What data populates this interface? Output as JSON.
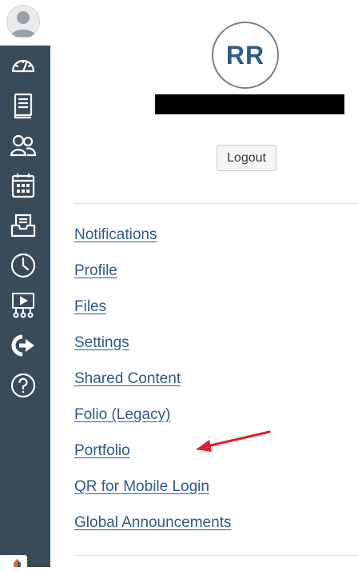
{
  "rail": {
    "items": [
      {
        "icon": "dashboard-speedometer-icon"
      },
      {
        "icon": "courses-book-icon"
      },
      {
        "icon": "groups-people-icon"
      },
      {
        "icon": "calendar-icon"
      },
      {
        "icon": "inbox-icon"
      },
      {
        "icon": "history-clock-icon"
      },
      {
        "icon": "studio-presentation-icon"
      },
      {
        "icon": "commons-share-icon"
      },
      {
        "icon": "help-question-icon"
      }
    ]
  },
  "account": {
    "initials": "RR",
    "logout_label": "Logout",
    "links": [
      {
        "label": "Notifications"
      },
      {
        "label": "Profile"
      },
      {
        "label": "Files"
      },
      {
        "label": "Settings"
      },
      {
        "label": "Shared Content"
      },
      {
        "label": "Folio (Legacy)"
      },
      {
        "label": "Portfolio"
      },
      {
        "label": "QR for Mobile Login"
      },
      {
        "label": "Global Announcements"
      }
    ]
  },
  "colors": {
    "rail_bg": "#394b58",
    "link": "#2d5b8a",
    "annotation_arrow": "#e0202a"
  }
}
